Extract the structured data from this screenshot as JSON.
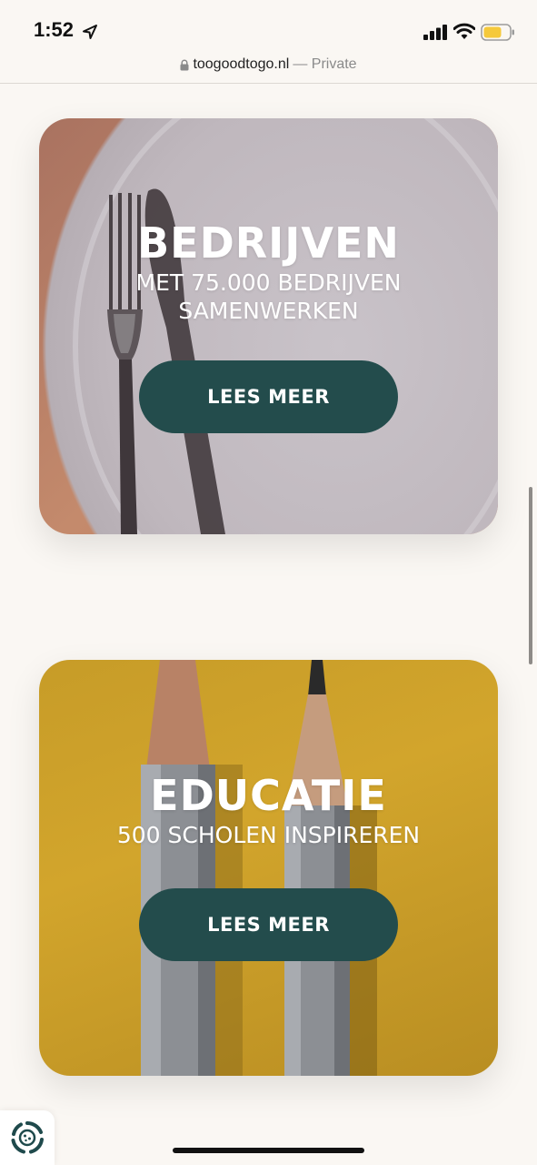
{
  "status_bar": {
    "time": "1:52",
    "icons": [
      "location-arrow-icon",
      "cellular-signal-icon",
      "wifi-icon",
      "battery-icon"
    ],
    "battery_color": "#f5c93b"
  },
  "url_bar": {
    "domain": "toogoodtogo.nl",
    "separator": " — ",
    "mode": "Private"
  },
  "cards": [
    {
      "title": "BEDRIJVEN",
      "subtitle_line1": "MET 75.000 BEDRIJVEN",
      "subtitle_line2": "SAMENWERKEN",
      "button_label": "LEES MEER",
      "image": "plate-with-fork"
    },
    {
      "title": "EDUCATIE",
      "subtitle_line1": "500 SCHOLEN INSPIREREN",
      "button_label": "LEES MEER",
      "image": "two-pencils"
    }
  ],
  "colors": {
    "background": "#faf7f3",
    "button": "#234c4c",
    "card_text": "#ffffff"
  },
  "consent_badge": {
    "icon": "cookie-consent-icon"
  }
}
